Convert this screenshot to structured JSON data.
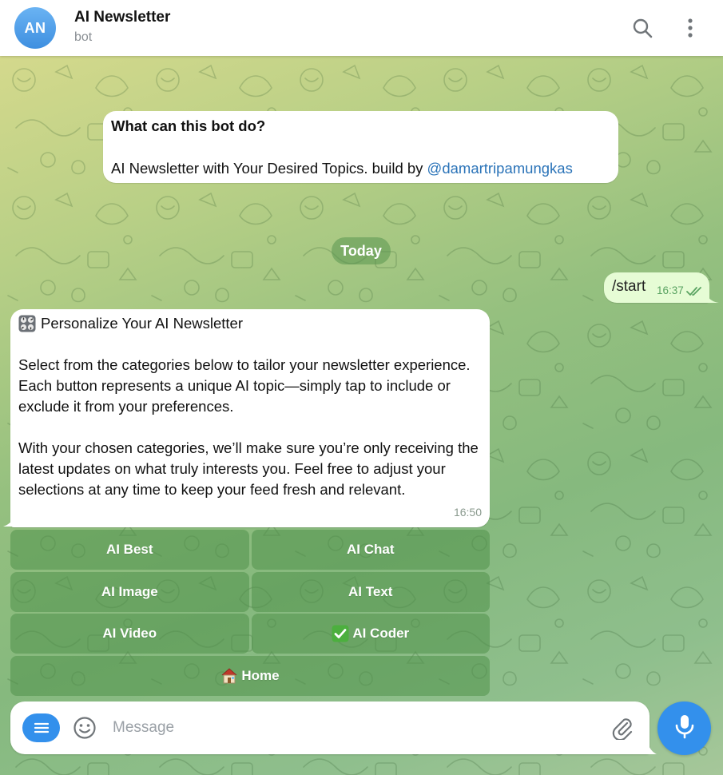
{
  "header": {
    "avatar_initials": "AN",
    "title": "AI Newsletter",
    "subtitle": "bot",
    "icons": [
      "search-icon",
      "more-vertical-icon"
    ]
  },
  "bot_info": {
    "title": "What can this bot do?",
    "text": "AI Newsletter with Your Desired Topics. build by ",
    "link": "@damartripamungkas"
  },
  "date_divider": "Today",
  "outgoing_message": {
    "text": "/start",
    "time": "16:37",
    "status": "read"
  },
  "incoming_message": {
    "heading": "Personalize Your AI Newsletter",
    "heading_emoji": "control-knobs",
    "paragraph1": "Select from the categories below to tailor your newsletter experience. Each button represents a unique AI topic—simply tap to include or exclude it from your preferences.",
    "paragraph2": "With your chosen categories, we’ll make sure you’re only receiving the latest updates on what truly interests you. Feel free to adjust your selections at any time to keep your feed fresh and relevant.",
    "time": "16:50"
  },
  "keyboard": {
    "rows": [
      [
        {
          "label": "AI Best"
        },
        {
          "label": "AI Chat"
        }
      ],
      [
        {
          "label": "AI Image"
        },
        {
          "label": "AI Text"
        }
      ],
      [
        {
          "label": "AI Video"
        },
        {
          "label": "AI Coder",
          "checked": true
        }
      ],
      [
        {
          "label": "Home",
          "emoji": "house"
        }
      ]
    ]
  },
  "composer": {
    "placeholder": "Message",
    "icons": [
      "menu-icon",
      "emoji-icon",
      "attach-icon",
      "microphone-icon"
    ]
  },
  "colors": {
    "accent": "#3390ec",
    "outgoing_bubble": "#e6fcd5",
    "link": "#2a73b8",
    "keyboard_button": "#6aa465"
  }
}
